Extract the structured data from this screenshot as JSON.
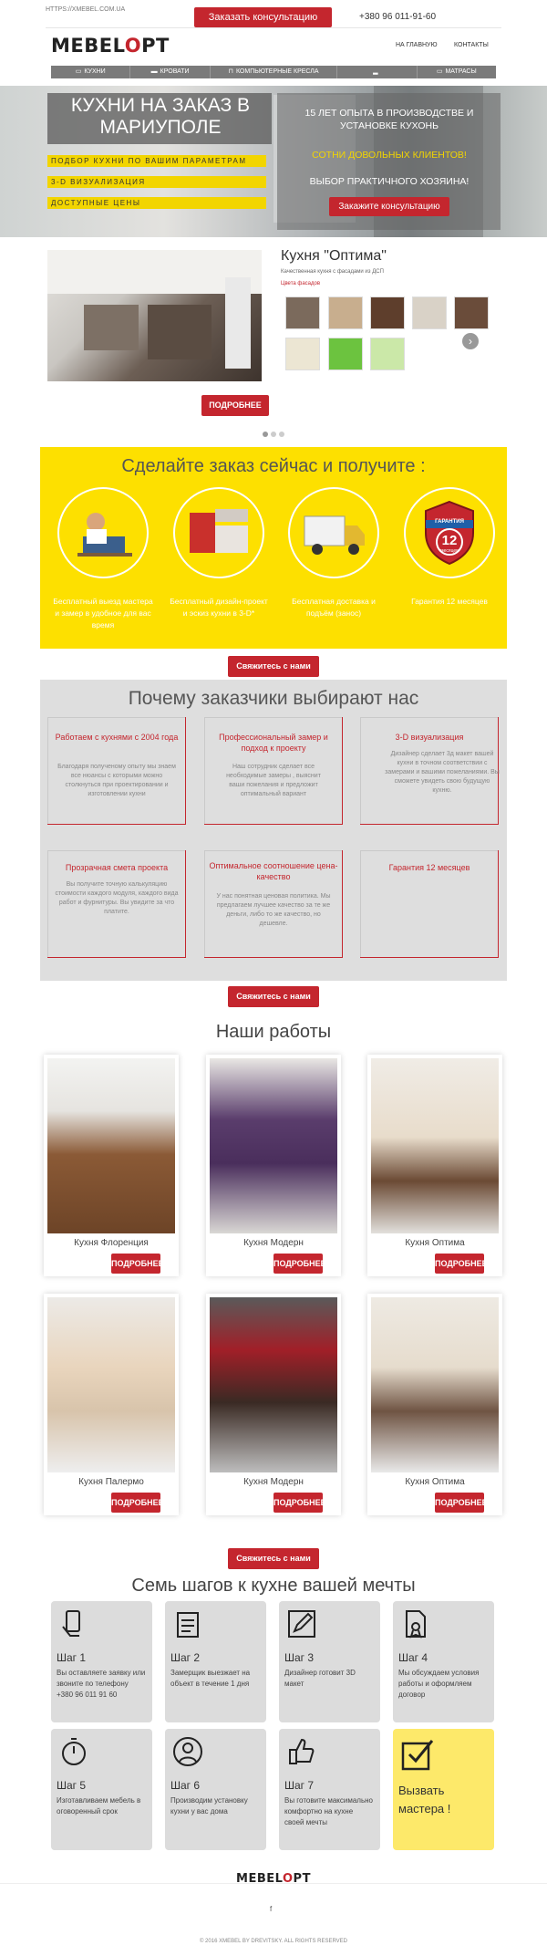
{
  "header": {
    "url": "HTTPS://XMEBEL.COM.UA",
    "consult_button": "Заказать консультацию",
    "phone": "+380 96 011-91-60",
    "logo_left": "MEBEL",
    "logo_o": "O",
    "logo_right": "PT",
    "nav": [
      "НА ГЛАВНУЮ",
      "КОНТАКТЫ"
    ],
    "categories": [
      "КУХНИ",
      "КРОВАТИ",
      "КОМПЬЮТЕРНЫЕ КРЕСЛА",
      "",
      "МАТРАСЫ"
    ]
  },
  "hero": {
    "title": "КУХНИ НА ЗАКАЗ В МАРИУПОЛЕ",
    "features": [
      "ПОДБОР КУХНИ ПО ВАШИМ ПАРАМЕТРАМ",
      "3-D ВИЗУАЛИЗАЦИЯ",
      "ДОСТУПНЫЕ ЦЕНЫ"
    ],
    "right_line1": "15 ЛЕТ ОПЫТА В ПРОИЗВОДСТВЕ И УСТАНОВКЕ КУХОНЬ",
    "right_line2": "СОТНИ ДОВОЛЬНЫХ КЛИЕНТОВ!",
    "right_line3": "ВЫБОР ПРАКТИЧНОГО ХОЗЯИНА!",
    "consult_button": "Закажите консультацию"
  },
  "product": {
    "title": "Кухня \"Оптима\"",
    "subtitle": "Качественная кухня с фасадами из ДСП",
    "colors_link": "Цвета фасадов",
    "swatch_colors": [
      "#7b6a5c",
      "#c8ae8e",
      "#5e3e2c",
      "#d9d2c7",
      "#6a4c3a",
      "#ece6d3",
      "#6cc33f",
      "#cbe8a8"
    ],
    "more_button": "ПОДРОБНЕЕ",
    "slider_arrow": "›"
  },
  "offer": {
    "title": "Сделайте заказ сейчас и получите :",
    "items": [
      {
        "text": "Бесплатный выезд мастера и замер в удобное для вас время",
        "icon": "worker-icon"
      },
      {
        "text": "Бесплатный дизайн-проект и эскиз кухни в 3-D*",
        "icon": "kitchen-3d-icon"
      },
      {
        "text": "Бесплатная доставка и подъём (занос)",
        "icon": "truck-icon"
      },
      {
        "text": "Гарантия 12 месяцев",
        "icon": "warranty-badge-icon"
      }
    ],
    "badge_top": "ГАРАНТИЯ",
    "badge_num": "12",
    "badge_bottom": "месяцев",
    "contact_button": "Свяжитесь с нами"
  },
  "why": {
    "title": "Почему заказчики выбирают нас",
    "items": [
      {
        "title": "Работаем с кухнями с 2004 года",
        "desc": "Благодаря полученому опыту мы знаем все нюансы с которыми можно столкнуться при проектировании и изготовлении кухни"
      },
      {
        "title": "Профессиональный замер и подход к проекту",
        "desc": "Наш сотрудник сделает все необходимые замеры , выяснит ваши пожелания и предложит оптимальный вариант"
      },
      {
        "title": "3-D визуализация",
        "desc": "Дизайнер сделает 3д макет вашей кухни в точном соответствии с замерами и вашими пожеланиями. Вы сможете увидеть свою будущую кухню."
      },
      {
        "title": "Прозрачная смета проекта",
        "desc": "Вы получите точную калькуляцию стоимости каждого модуля, каждого вида работ и фурнитуры. Вы увидите за что платите."
      },
      {
        "title": "Оптимальное соотношение цена-качество",
        "desc": "У нас понятная ценовая политика. Мы предлагаем лучшее качество за те же деньги, либо то же качество, но дешевле."
      },
      {
        "title": "Гарантия 12 месяцев",
        "desc": ""
      }
    ],
    "contact_button": "Свяжитесь с нами"
  },
  "works": {
    "title": "Наши работы",
    "items": [
      {
        "name": "Кухня Флоренция",
        "button": "ПОДРОБНЕЕ"
      },
      {
        "name": "Кухня Модерн",
        "button": "ПОДРОБНЕЕ"
      },
      {
        "name": "Кухня Оптима",
        "button": "ПОДРОБНЕЕ"
      },
      {
        "name": "Кухня Палермо",
        "button": "ПОДРОБНЕЕ"
      },
      {
        "name": "Кухня Модерн",
        "button": "ПОДРОБНЕЕ"
      },
      {
        "name": "Кухня Оптима",
        "button": "ПОДРОБНЕЕ"
      }
    ],
    "contact_button": "Свяжитесь с нами"
  },
  "steps": {
    "title": "Семь шагов к кухне вашей мечты",
    "items": [
      {
        "title": "Шаг 1",
        "desc": "Вы оставляете заявку или звоните по телефону +380 96 011 91 60",
        "icon": "phone-hand-icon"
      },
      {
        "title": "Шаг 2",
        "desc": "Замерщик выезжает на объект в течение 1 дня",
        "icon": "clipboard-icon"
      },
      {
        "title": "Шаг 3",
        "desc": "Дизайнер готовит 3D макет",
        "icon": "pencil-icon"
      },
      {
        "title": "Шаг 4",
        "desc": "Мы обсуждаем условия работы и оформляем договор",
        "icon": "contract-icon"
      },
      {
        "title": "Шаг 5",
        "desc": "Изготавливаем мебель в оговоренный срок",
        "icon": "stopwatch-icon"
      },
      {
        "title": "Шаг 6",
        "desc": "Производим установку кухни у вас дома",
        "icon": "worker-avatar-icon"
      },
      {
        "title": "Шаг 7",
        "desc": "Вы готовите максимально комфортно на кухне своей мечты",
        "icon": "thumbs-up-icon"
      }
    ],
    "call_label": "Вызвать мастера !"
  },
  "footer": {
    "logo_left": "MEBEL",
    "logo_o": "O",
    "logo_right": "PT",
    "social": "f",
    "copyright": "© 2016 XMEBEL BY DREVITSKY. ALL RIGHTS RESERVED"
  }
}
